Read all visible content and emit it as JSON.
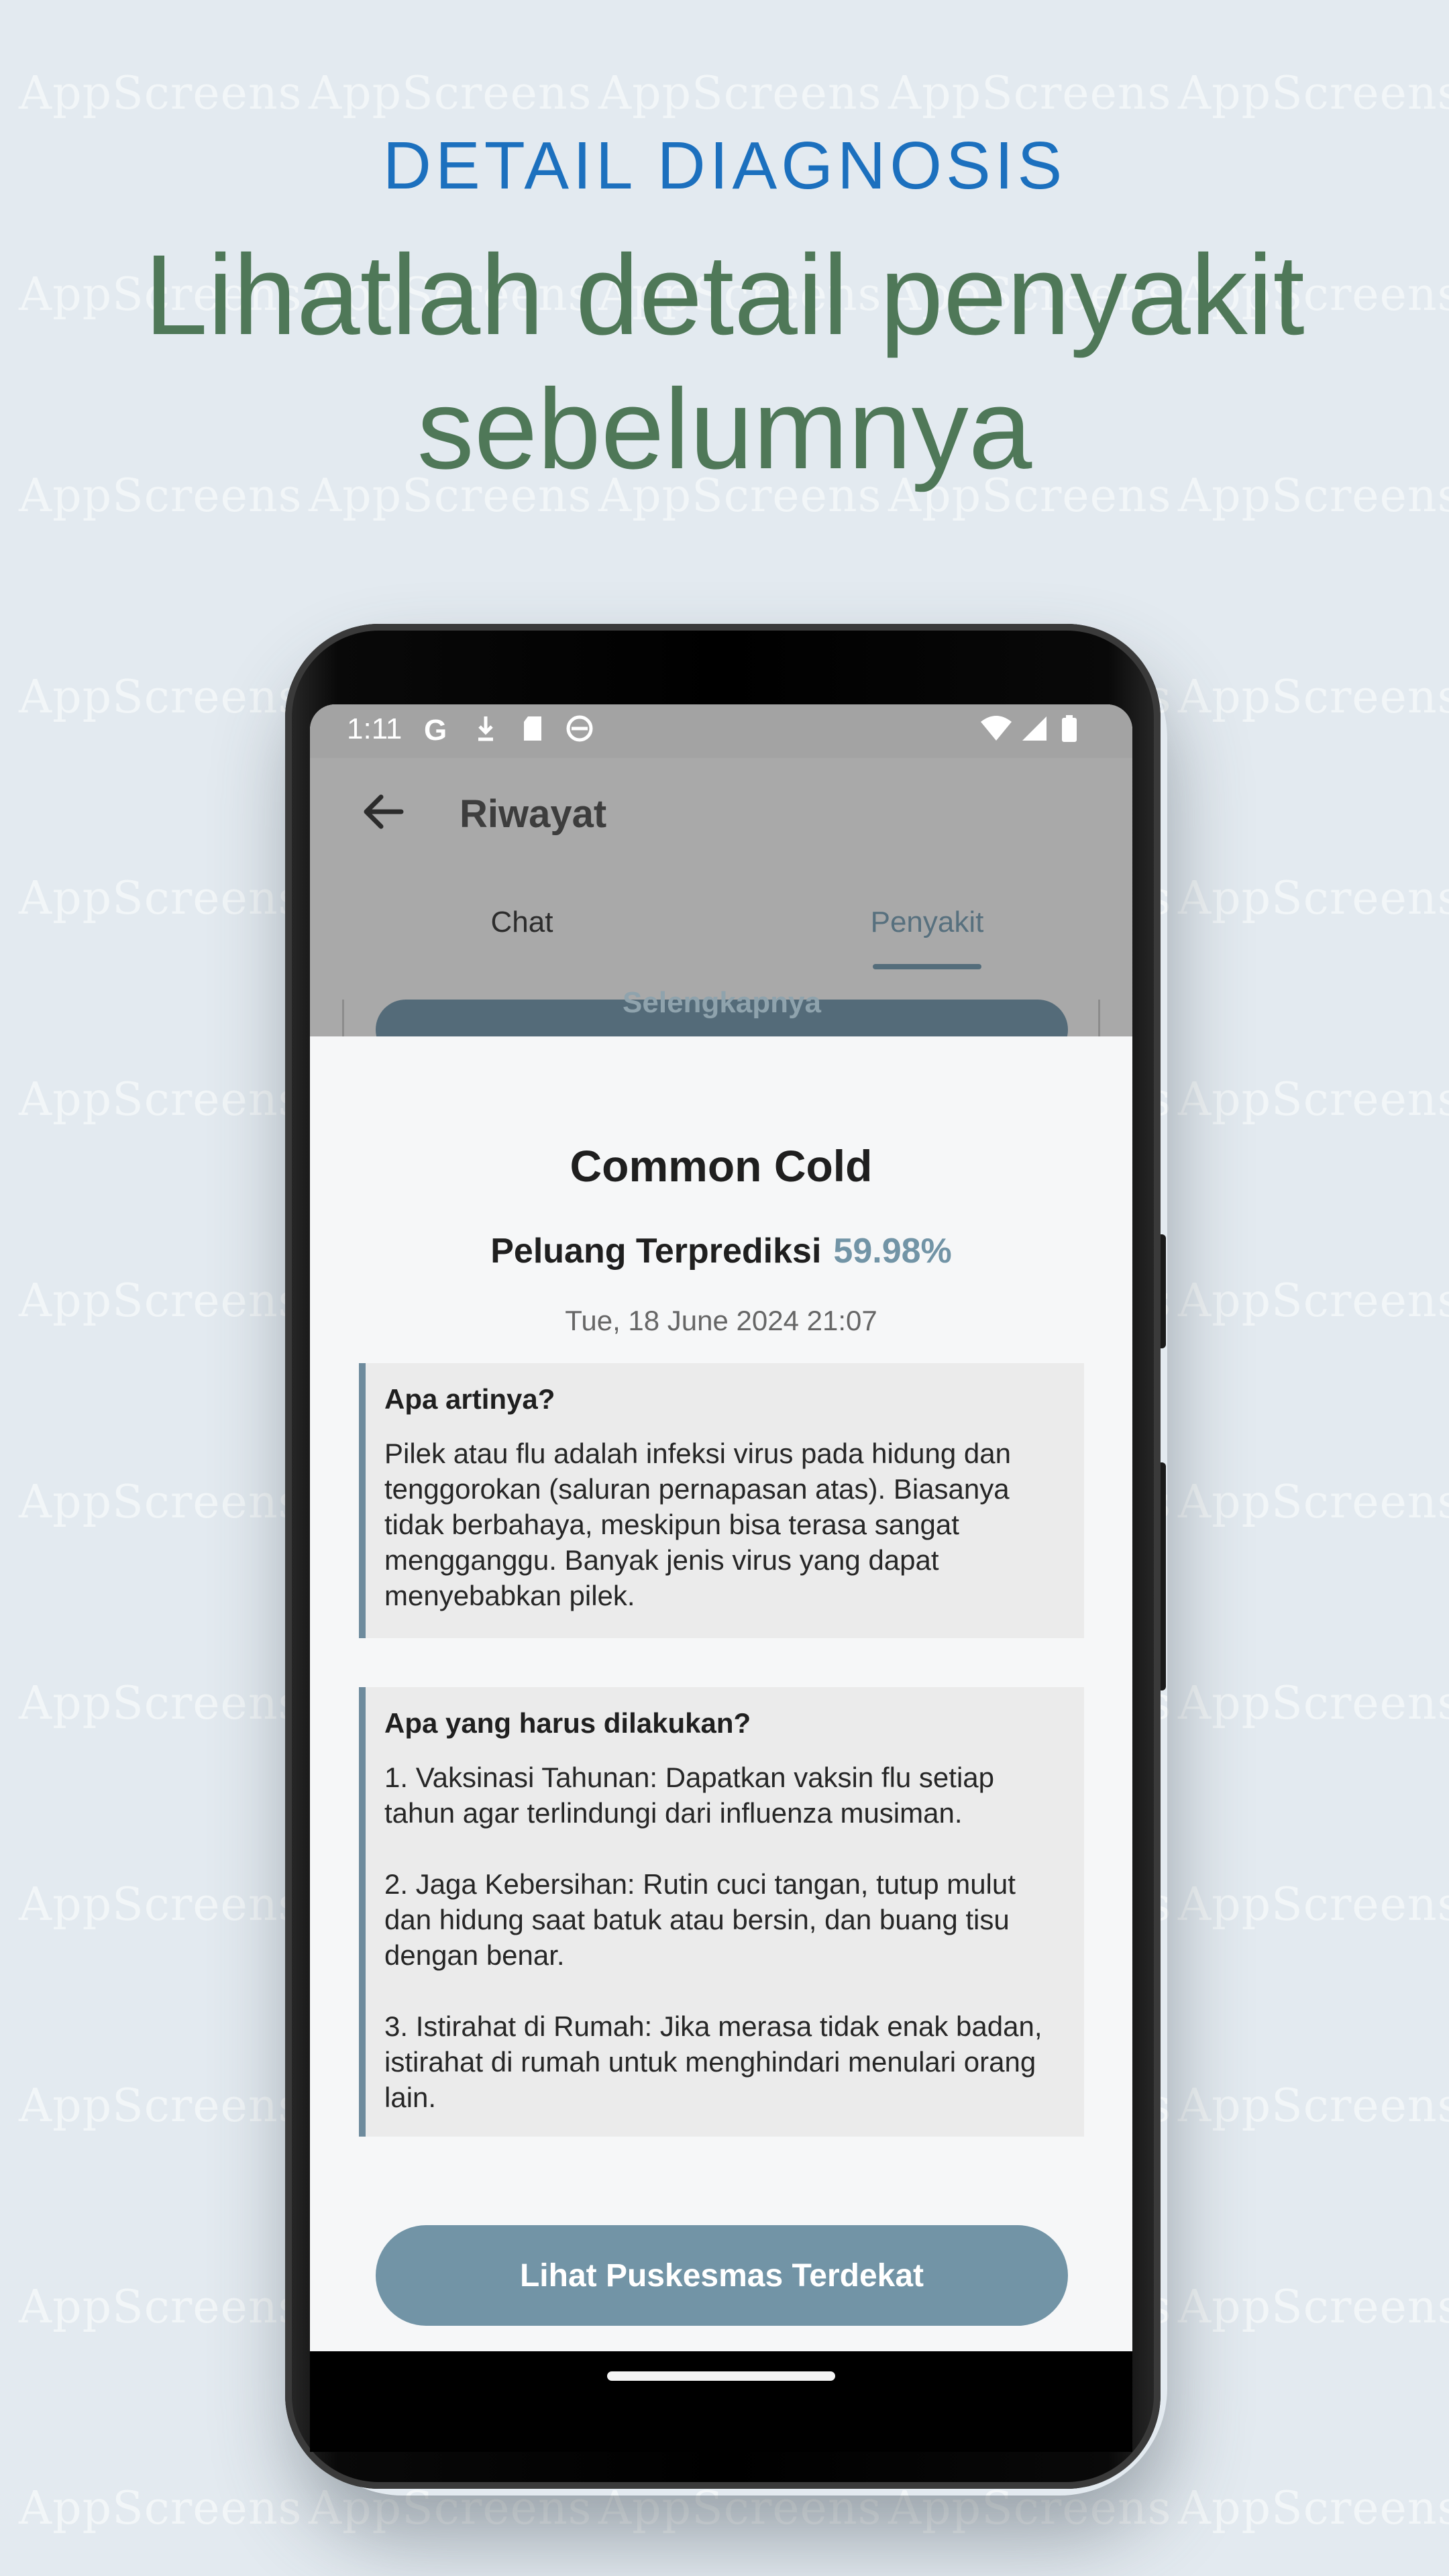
{
  "watermark": "AppScreens",
  "promo": {
    "eyebrow": "DETAIL DIAGNOSIS",
    "headline": "Lihatlah detail penyakit sebelumnya"
  },
  "status_bar": {
    "time": "1:11",
    "left_icons": [
      "google-g-icon",
      "download-icon",
      "sd-card-icon",
      "clock-icon"
    ],
    "right_icons": [
      "wifi-icon",
      "signal-icon",
      "battery-icon"
    ]
  },
  "app_bar": {
    "title": "Riwayat"
  },
  "tabs": [
    {
      "label": "Chat",
      "active": false
    },
    {
      "label": "Penyakit",
      "active": true
    }
  ],
  "background_button_label": "Selengkapnya",
  "detail": {
    "disease": "Common Cold",
    "probability_label": "Peluang Terprediksi",
    "probability_value": "59.98%",
    "timestamp": "Tue, 18 June 2024 21:07",
    "meaning": {
      "title": "Apa artinya?",
      "body": "Pilek atau flu adalah infeksi virus pada hidung dan tenggorokan (saluran pernapasan atas). Biasanya tidak berbahaya, meskipun bisa terasa sangat mengganggu. Banyak jenis virus yang dapat menyebabkan pilek."
    },
    "actions": {
      "title": "Apa yang harus dilakukan?",
      "body": "1. Vaksinasi Tahunan: Dapatkan vaksin flu setiap tahun agar terlindungi dari influenza musiman.\n\n2. Jaga Kebersihan: Rutin cuci tangan, tutup mulut dan hidung saat batuk atau bersin, dan buang tisu dengan benar.\n\n3. Istirahat di Rumah: Jika merasa tidak enak badan, istirahat di rumah untuk menghindari menulari orang lain."
    },
    "cta_label": "Lihat Puskesmas Terdekat"
  },
  "colors": {
    "background": "#e3eaf0",
    "eyebrow": "#1c70be",
    "headline": "#4f7858",
    "accent": "#7294a6"
  }
}
